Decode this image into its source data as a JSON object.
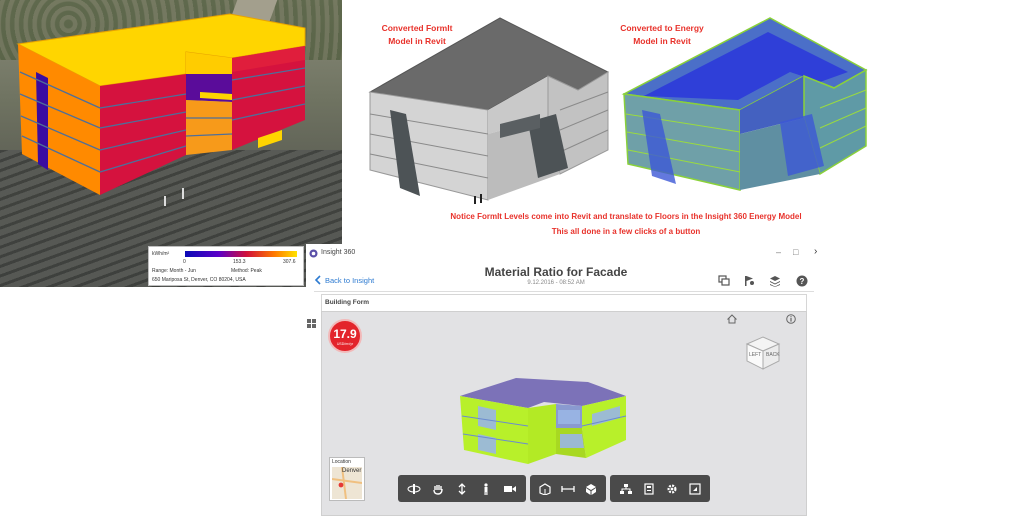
{
  "solar_panel": {
    "legend": {
      "unit_label": "kWh/m²",
      "tick_min": "0",
      "tick_mid": "153.3",
      "tick_max": "307.6",
      "range_label": "Range: Month - Jun",
      "method_label": "Method: Peak",
      "address": "650 Mariposa St, Denver, CO 80204, USA"
    }
  },
  "revit": {
    "formit_label_line1": "Converted FormIt",
    "formit_label_line2": "Model in Revit",
    "energy_label_line1": "Converted to Energy",
    "energy_label_line2": "Model in Revit",
    "note_line1": "Notice FormIt Levels come into Revit and translate to Floors in the Insight 360 Energy Model",
    "note_line2": "This all done in a few clicks of a button"
  },
  "insight_window": {
    "app_title": "Insight 360",
    "back_label": "Back to Insight",
    "page_title": "Material Ratio for Facade",
    "subtitle_date": "9.12.2016 - 08:52 AM",
    "section_title": "Building Form",
    "score_value": "17.9",
    "score_unit": "USD/m²/yr",
    "location_label": "Location",
    "map_city": "Denver",
    "viewcube_left": "LEFT",
    "viewcube_back": "BACK",
    "window_buttons": [
      "–",
      "□",
      "›"
    ],
    "accent_color": "#2e7bd1",
    "score_color": "#e3242b",
    "model_color": "#b8f02a"
  }
}
